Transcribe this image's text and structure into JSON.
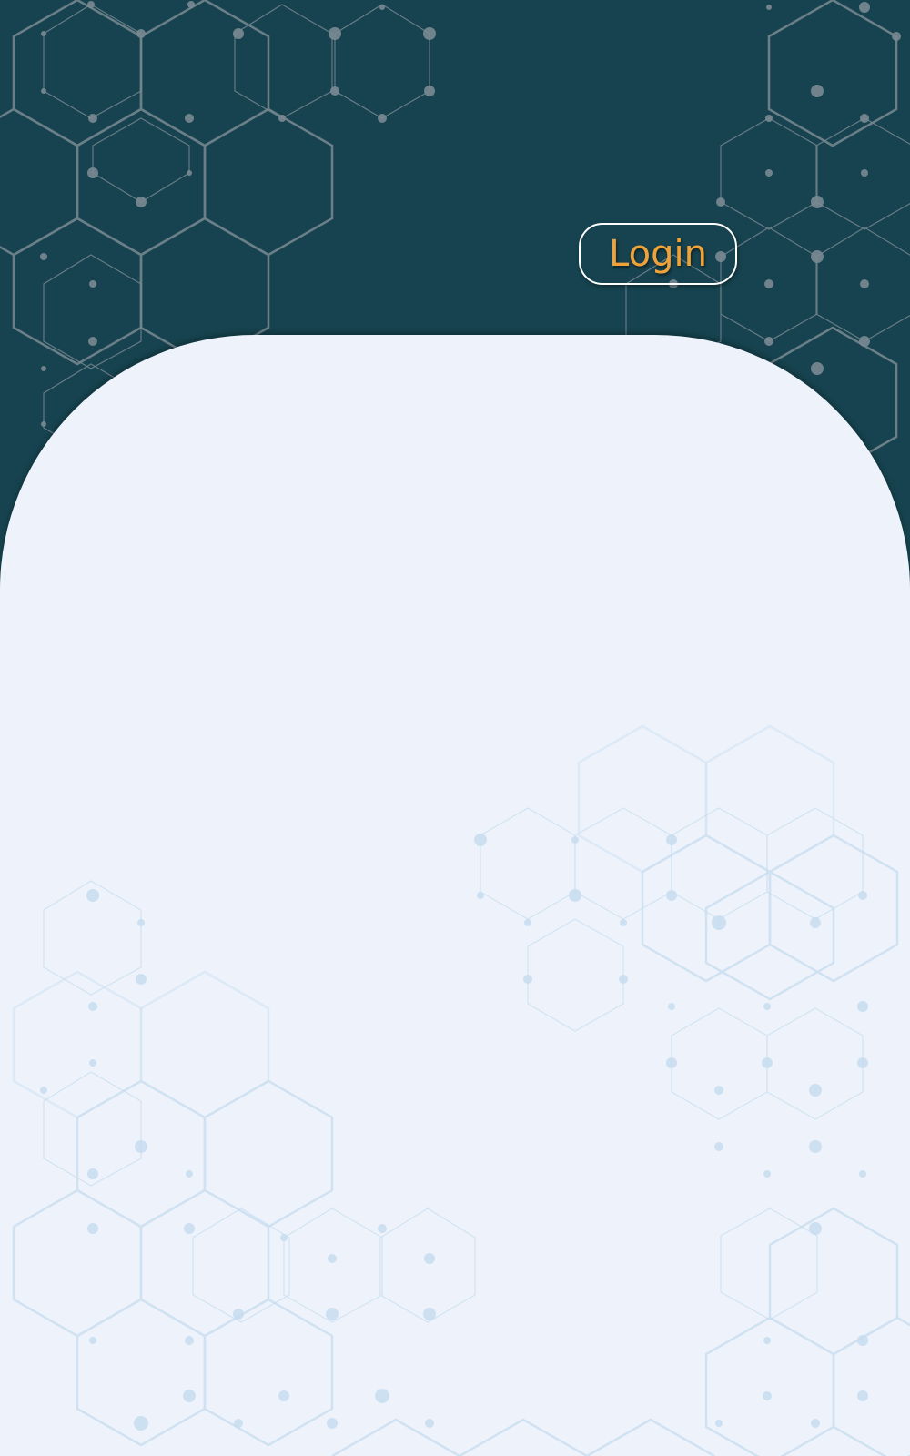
{
  "header": {
    "login_label": "Login"
  },
  "icons": {
    "background_pattern": "hexagon-network-pattern"
  },
  "colors": {
    "header_background": "#16434f",
    "panel_background": "#eef3fb",
    "login_text": "#f0a23a",
    "login_border": "#ffffff"
  }
}
